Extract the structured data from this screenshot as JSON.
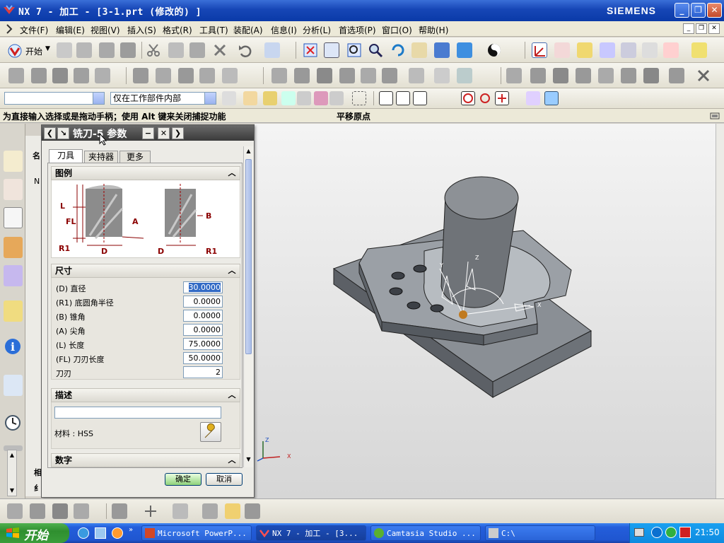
{
  "window": {
    "title": "NX 7 - 加工 - [3-1.prt (修改的) ]",
    "brand": "SIEMENS",
    "buttons": {
      "minimize": "_",
      "restore": "❐",
      "close": "✕"
    }
  },
  "menu": {
    "items": [
      "文件(F)",
      "编辑(E)",
      "视图(V)",
      "插入(S)",
      "格式(R)",
      "工具(T)",
      "装配(A)",
      "信息(I)",
      "分析(L)",
      "首选项(P)",
      "窗口(O)",
      "帮助(H)"
    ]
  },
  "toolbar": {
    "start_label": "开始",
    "filter_combo_value": "",
    "scope_combo_value": "仅在工作部件内部"
  },
  "cue": {
    "prompt": "为直接输入选择或是拖动手柄；使用 Alt 键来关闭捕捉功能",
    "status": "平移原点"
  },
  "dialog": {
    "title": "铣刀-5 参数",
    "tabs": [
      "刀具",
      "夹持器",
      "更多"
    ],
    "groups": {
      "legend": "图例",
      "dimensions": "尺寸",
      "description": "描述",
      "numbers": "数字"
    },
    "diagram_labels": {
      "L": "L",
      "FL": "FL",
      "R1": "R1",
      "D": "D",
      "A": "A",
      "B": "B"
    },
    "params": [
      {
        "label": "(D) 直径",
        "value": "30.0000"
      },
      {
        "label": "(R1) 底圆角半径",
        "value": "0.0000"
      },
      {
        "label": "(B) 锥角",
        "value": "0.0000"
      },
      {
        "label": "(A) 尖角",
        "value": "0.0000"
      },
      {
        "label": "(L) 长度",
        "value": "75.0000"
      },
      {
        "label": "(FL) 刀刃长度",
        "value": "50.0000"
      },
      {
        "label": "刀刃",
        "value": "2"
      }
    ],
    "description_value": "",
    "material": "材料 : HSS",
    "ok": "确定",
    "cancel": "取消"
  },
  "navigator": {
    "row1": "名",
    "row2": "N",
    "bottom1": "相",
    "bottom2": "纟"
  },
  "viewport": {
    "csys_labels": {
      "x": "X",
      "y": "Y",
      "z": "Z"
    },
    "small_csys": {
      "x": "X",
      "z": "Z"
    }
  },
  "taskbar": {
    "start": "开始",
    "tasks": [
      {
        "label": "Microsoft PowerP..."
      },
      {
        "label": "NX 7 - 加工 - [3..."
      },
      {
        "label": "Camtasia Studio ..."
      },
      {
        "label": "C:\\"
      }
    ],
    "clock": "21:50"
  },
  "colors": {
    "title_blue": "#1646b6",
    "part_gray": "#7d8288",
    "tool_gray": "#6e6e6e",
    "taskbar_blue": "#245edb"
  }
}
